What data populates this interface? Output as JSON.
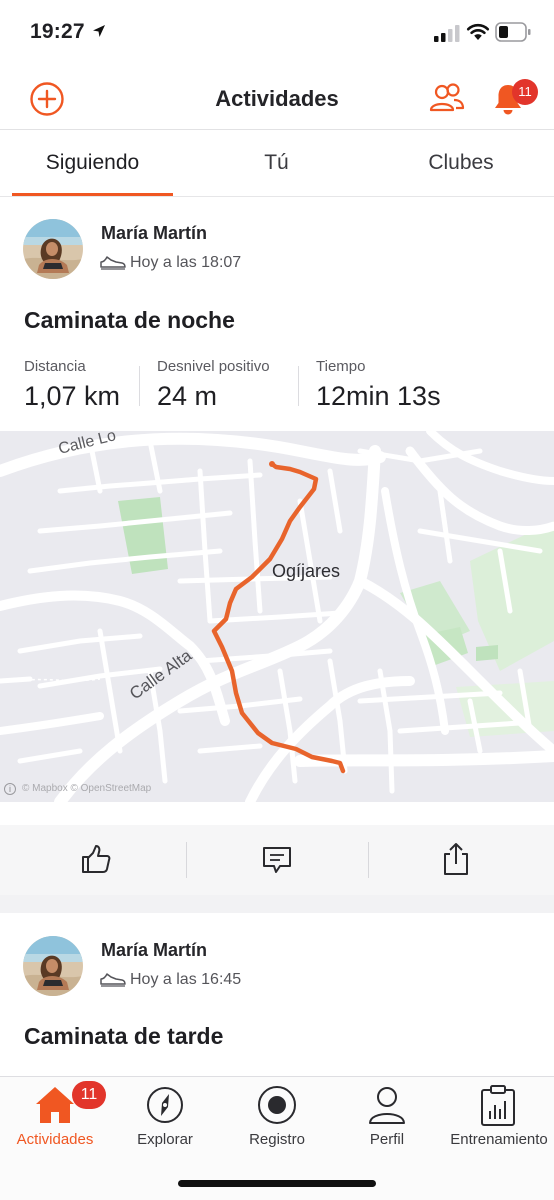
{
  "status_bar": {
    "time": "19:27"
  },
  "header": {
    "title": "Actividades",
    "notification_count": "11"
  },
  "tabs": [
    {
      "label": "Siguiendo",
      "selected": true
    },
    {
      "label": "Tú",
      "selected": false
    },
    {
      "label": "Clubes",
      "selected": false
    }
  ],
  "activities": [
    {
      "athlete": "María Martín",
      "time": "Hoy a las 18:07",
      "title": "Caminata de noche",
      "stats": [
        {
          "label": "Distancia",
          "value": "1,07 km"
        },
        {
          "label": "Desnivel positivo",
          "value": "24 m"
        },
        {
          "label": "Tiempo",
          "value": "12min 13s"
        }
      ],
      "map": {
        "town": "Ogíjares",
        "streets": [
          "Calle Alta",
          "Calle Lo"
        ],
        "attribution": "© Mapbox © OpenStreetMap",
        "route_color": "#e8642c"
      }
    },
    {
      "athlete": "María Martín",
      "time": "Hoy a las 16:45",
      "title": "Caminata de tarde"
    }
  ],
  "actions": [
    "like-icon",
    "comment-icon",
    "share-icon"
  ],
  "tabbar": [
    {
      "label": "Actividades",
      "icon": "home-icon",
      "selected": true,
      "badge": "11"
    },
    {
      "label": "Explorar",
      "icon": "compass-icon",
      "selected": false
    },
    {
      "label": "Registro",
      "icon": "record-icon",
      "selected": false
    },
    {
      "label": "Perfil",
      "icon": "profile-icon",
      "selected": false
    },
    {
      "label": "Entrenamiento",
      "icon": "training-icon",
      "selected": false
    }
  ],
  "colors": {
    "accent": "#f05722",
    "badge": "#e2352b"
  }
}
